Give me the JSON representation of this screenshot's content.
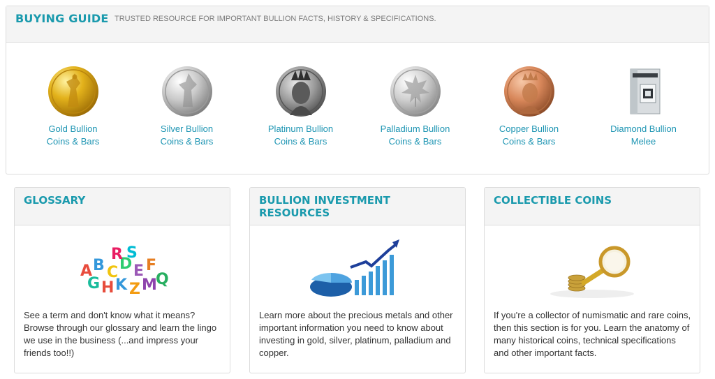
{
  "buying_guide": {
    "title": "BUYING GUIDE",
    "subtitle": "TRUSTED RESOURCE FOR IMPORTANT BULLION FACTS, HISTORY & SPECIFICATIONS.",
    "categories": [
      {
        "line1": "Gold Bullion",
        "line2": "Coins & Bars",
        "icon": "gold-coin-icon"
      },
      {
        "line1": "Silver Bullion",
        "line2": "Coins & Bars",
        "icon": "silver-coin-icon"
      },
      {
        "line1": "Platinum Bullion",
        "line2": "Coins & Bars",
        "icon": "platinum-coin-icon"
      },
      {
        "line1": "Palladium Bullion",
        "line2": "Coins & Bars",
        "icon": "palladium-coin-icon"
      },
      {
        "line1": "Copper Bullion",
        "line2": "Coins & Bars",
        "icon": "copper-coin-icon"
      },
      {
        "line1": "Diamond Bullion",
        "line2": "Melee",
        "icon": "diamond-package-icon"
      }
    ]
  },
  "cards": [
    {
      "title_line1": "GLOSSARY",
      "title_line2": "",
      "image": "alphabet-letters-image",
      "text": "See a term and don't know what it means? Browse through our glossary and learn the lingo we use in the business (...and impress your friends too!!)"
    },
    {
      "title_line1": "BULLION INVESTMENT",
      "title_line2": "RESOURCES",
      "image": "investment-chart-image",
      "text": "Learn more about the precious metals and other important information you need to know about investing in gold, silver, platinum, palladium and copper."
    },
    {
      "title_line1": "COLLECTIBLE COINS",
      "title_line2": "",
      "image": "magnifying-glass-coins-image",
      "text": "If you're a collector of numismatic and rare coins, then this section is for you. Learn the anatomy of many historical coins, technical specifications and other important facts."
    }
  ],
  "colors": {
    "accent": "#1a9aad",
    "link": "#1e95b3",
    "panel_header": "#f4f4f4",
    "border": "#dcdcdc"
  }
}
